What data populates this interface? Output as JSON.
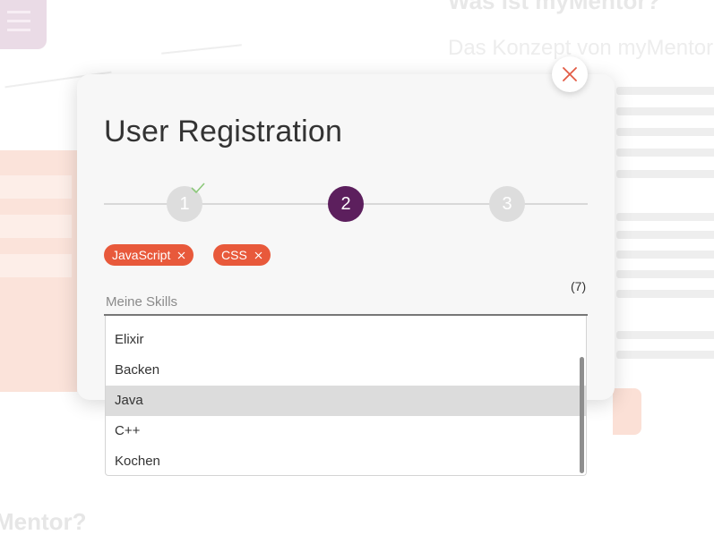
{
  "modal": {
    "title": "User Registration",
    "close_icon": "close-icon"
  },
  "stepper": {
    "steps": [
      {
        "label": "1",
        "state": "completed"
      },
      {
        "label": "2",
        "state": "active"
      },
      {
        "label": "3",
        "state": "upcoming"
      }
    ],
    "check_icon": "check-icon"
  },
  "selected_skills": [
    {
      "label": "JavaScript",
      "remove_icon": "close-icon"
    },
    {
      "label": "CSS",
      "remove_icon": "close-icon"
    }
  ],
  "skills_field": {
    "placeholder": "Meine Skills",
    "value": "",
    "count": "(7)"
  },
  "dropdown": {
    "options": [
      "Elixir",
      "Backen",
      "Java",
      "C++",
      "Kochen"
    ],
    "highlighted": "Java"
  },
  "colors": {
    "accent_purple": "#5c1f5d",
    "chip_orange": "#e8593b",
    "close_red": "#e25b45",
    "check_green": "#8cc97a",
    "step_inactive": "#dddddd"
  }
}
